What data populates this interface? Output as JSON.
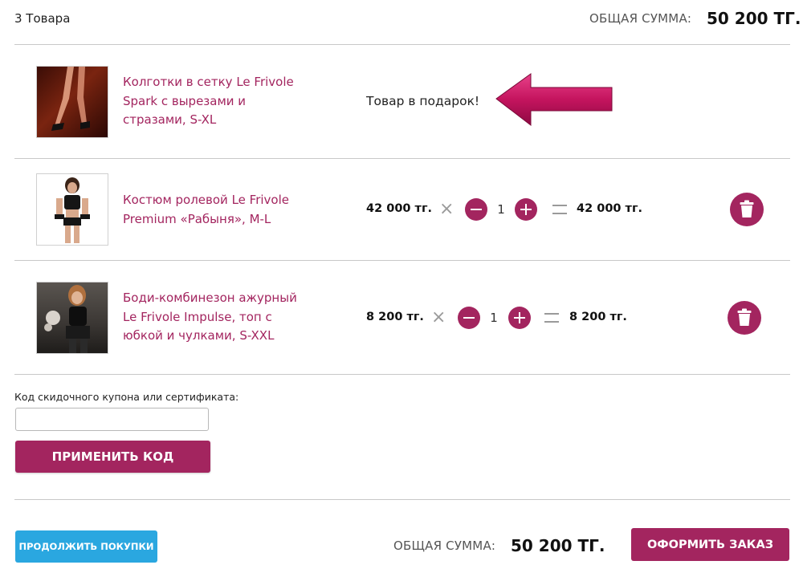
{
  "header": {
    "item_count": "3 Товара",
    "total_label": "ОБЩАЯ СУММА:",
    "total_value": "50 200 ТГ."
  },
  "items": [
    {
      "name_lines": [
        "Колготки в сетку Le Frivole",
        "Spark с вырезами и",
        "стразами, S-XL"
      ],
      "gift_text": "Товар в подарок!"
    },
    {
      "name_lines": [
        "Костюм ролевой Le Frivole",
        "Premium «Рабыня», M-L"
      ],
      "price": "42 000 тг.",
      "quantity": "1",
      "subtotal": "42 000 тг."
    },
    {
      "name_lines": [
        "Боди-комбинезон ажурный",
        "Le Frivole Impulse, топ с",
        "юбкой и чулками, S-XXL"
      ],
      "price": "8 200 тг.",
      "quantity": "1",
      "subtotal": "8 200 тг."
    }
  ],
  "coupon": {
    "label": "Код скидочного купона или сертификата:",
    "value": "",
    "apply_label": "ПРИМЕНИТЬ КОД"
  },
  "footer": {
    "continue_label": "ПРОДОЛЖИТЬ ПОКУПКИ",
    "total_label": "ОБЩАЯ СУММА:",
    "total_value": "50 200 ТГ.",
    "order_label": "ОФОРМИТЬ ЗАКАЗ"
  },
  "icons": {
    "gift_pointer": "arrow-left-icon",
    "decrease": "minus-icon",
    "increase": "plus-icon",
    "delete": "trash-icon",
    "multiply": "times-icon",
    "equals": "equals-icon"
  },
  "colors": {
    "accent": "#a3255f",
    "continue_button": "#2aa7e0",
    "arrow": "#c4145e"
  }
}
